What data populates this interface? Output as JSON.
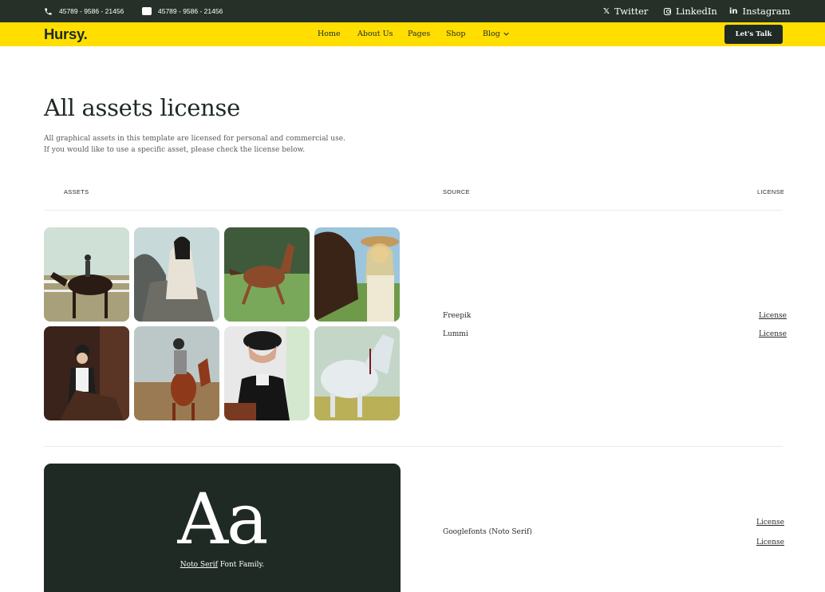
{
  "topbar": {
    "phone": "45789 - 9586 - 21456",
    "message_phone": "45789 - 9586 - 21456",
    "social": [
      {
        "icon": "x-twitter-icon",
        "label": "Twitter"
      },
      {
        "icon": "instagram-icon",
        "label": "LinkedIn"
      },
      {
        "icon": "linkedin-icon",
        "label": "Instagram"
      }
    ]
  },
  "nav": {
    "logo": "Hursy.",
    "items": [
      "Home",
      "About Us",
      "Pages",
      "Shop",
      "Blog"
    ],
    "cta": "Let's Talk"
  },
  "page": {
    "title": "All assets license",
    "intro": "All graphical assets in this template are licensed for personal and commercial use. If you would like to use a specific asset, please check the license below."
  },
  "table": {
    "headers": {
      "assets": "ASSETS",
      "source": "SOURCE",
      "license": "LICENSE"
    },
    "images_rows": [
      {
        "source": "Freepik",
        "license": "License"
      },
      {
        "source": "Lummi",
        "license": "License"
      }
    ],
    "font_row": {
      "source": "Googlefonts (Noto Serif)",
      "licenses": [
        "License",
        "License"
      ],
      "sample": "Aa",
      "caption_link": "Noto Serif",
      "caption_rest": " Font Family."
    }
  },
  "colors": {
    "topbar_bg": "#263029",
    "nav_bg": "#ffde00",
    "cta_bg": "#1f2a24",
    "font_card_bg": "#1f2a24"
  }
}
